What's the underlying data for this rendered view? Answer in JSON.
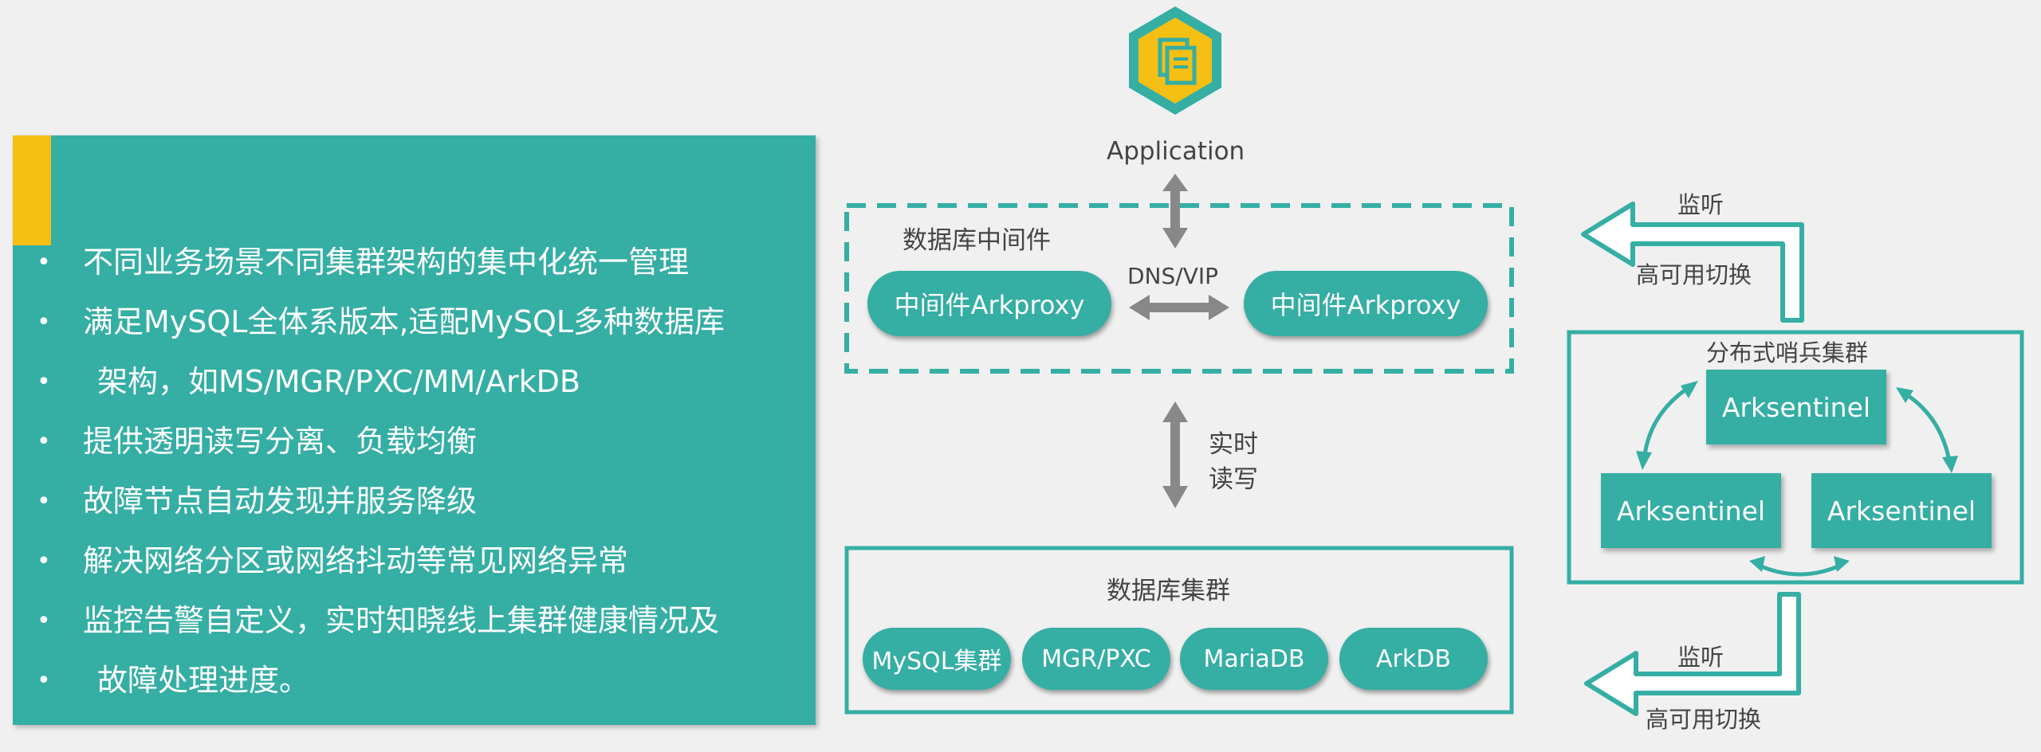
{
  "left_panel": {
    "bullets": [
      "不同业务场景不同集群架构的集中化统一管理",
      "满足MySQL全体系版本,适配MySQL多种数据库",
      "架构，如MS/MGR/PXC/MM/ArkDB",
      "提供透明读写分离、负载均衡",
      "故障节点自动发现并服务降级",
      "解决网络分区或网络抖动等常见网络异常",
      "监控告警自定义，实时知晓线上集群健康情况及",
      "故障处理进度。"
    ]
  },
  "application": {
    "label": "Application"
  },
  "middleware": {
    "title": "数据库中间件",
    "proxy_left": "中间件Arkproxy",
    "proxy_right": "中间件Arkproxy",
    "dns_label": "DNS/VIP"
  },
  "realtime": {
    "line1": "实时",
    "line2": "读写"
  },
  "cluster": {
    "title": "数据库集群",
    "items": [
      "MySQL集群",
      "MGR/PXC",
      "MariaDB",
      "ArkDB"
    ]
  },
  "sentinel": {
    "title": "分布式哨兵集群",
    "nodes": [
      "Arksentinel",
      "Arksentinel",
      "Arksentinel"
    ]
  },
  "top_arrow": {
    "listen": "监听",
    "failover": "高可用切换"
  },
  "bottom_arrow": {
    "listen": "监听",
    "failover": "高可用切换"
  },
  "colors": {
    "teal": "#35aea4",
    "yellow": "#f5bf14",
    "gray": "#888888"
  }
}
